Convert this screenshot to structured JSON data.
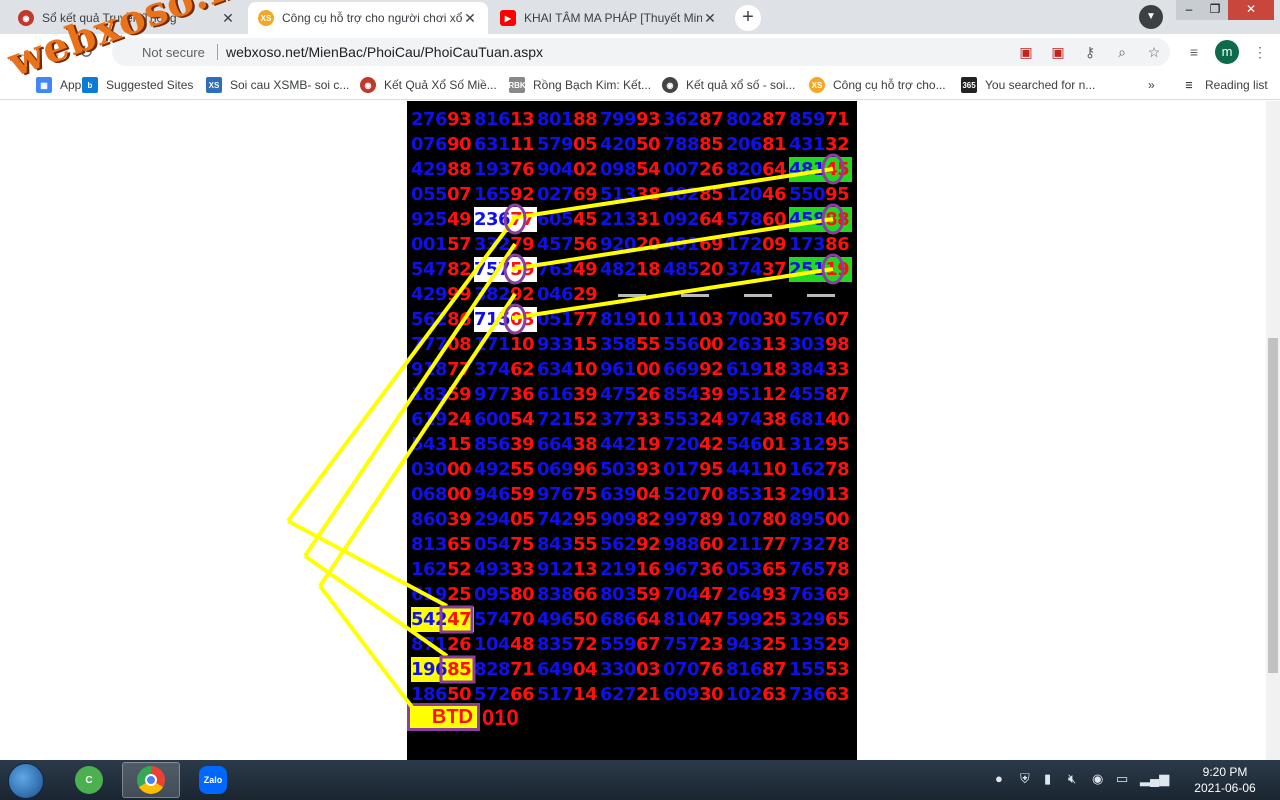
{
  "browser": {
    "tabs": [
      {
        "title": "Sổ kết quả Truyền Thống",
        "icon": "globe-icon",
        "color": "#c0392b",
        "active": false
      },
      {
        "title": "Công cụ hỗ trợ cho người chơi xổ",
        "icon": "xs-icon",
        "color": "#f5a623",
        "active": true
      },
      {
        "title": "KHAI TÂM MA PHÁP [Thuyết Min",
        "icon": "youtube-icon",
        "color": "#ff0000",
        "active": false
      }
    ],
    "security_label": "Not secure",
    "url": "webxoso.net/MienBac/PhoiCau/PhoiCauTuan.aspx",
    "avatar_letter": "m"
  },
  "bookmarks": [
    {
      "label": "Apps",
      "color": "#4285f4"
    },
    {
      "label": "Suggested Sites",
      "color": "#0a7bd6"
    },
    {
      "label": "Soi cau XSMB- soi c...",
      "color": "#2e6fb7"
    },
    {
      "label": "Kết Quả Xổ Số Miề...",
      "color": "#c0392b"
    },
    {
      "label": "Rồng Bạch Kim: Kết...",
      "color": "#888888"
    },
    {
      "label": "Kết quả xổ số - soi...",
      "color": "#444444"
    },
    {
      "label": "Công cụ hỗ trợ cho...",
      "color": "#f5a623"
    },
    {
      "label": "You searched for n...",
      "color": "#222222"
    }
  ],
  "reading_list_label": "Reading list",
  "watermark": "webxoso.net",
  "board": {
    "rows": [
      [
        "27693",
        "81613",
        "80188",
        "79993",
        "36287",
        "80287",
        "85971"
      ],
      [
        "07690",
        "63111",
        "57905",
        "42050",
        "78885",
        "20681",
        "43132"
      ],
      [
        "42988",
        "19376",
        "90402",
        "09854",
        "00726",
        "82064",
        "48145"
      ],
      [
        "05507",
        "16592",
        "02769",
        "51338",
        "40285",
        "12046",
        "55095"
      ],
      [
        "92549",
        "23677",
        "60545",
        "21331",
        "09264",
        "57860",
        "45888"
      ],
      [
        "00157",
        "33279",
        "45756",
        "92020",
        "40169",
        "17209",
        "17386"
      ],
      [
        "54782",
        "75759",
        "76349",
        "48218",
        "48520",
        "37437",
        "25119"
      ],
      [
        "42999",
        "38292",
        "04629",
        "—",
        "—",
        "—",
        "—"
      ],
      [
        "56286",
        "71503",
        "05177",
        "81910",
        "11103",
        "70030",
        "57607"
      ],
      [
        "77708",
        "17110",
        "93315",
        "35855",
        "55600",
        "26313",
        "30398"
      ],
      [
        "91877",
        "37462",
        "63410",
        "96100",
        "66992",
        "61918",
        "38433"
      ],
      [
        "18359",
        "97736",
        "61639",
        "47526",
        "85439",
        "95112",
        "45587"
      ],
      [
        "61924",
        "60054",
        "72152",
        "37733",
        "55324",
        "97438",
        "68140"
      ],
      [
        "54315",
        "85639",
        "66438",
        "44219",
        "72042",
        "54601",
        "31295"
      ],
      [
        "03000",
        "49255",
        "06996",
        "50393",
        "01795",
        "44110",
        "16278"
      ],
      [
        "06800",
        "94659",
        "97675",
        "63904",
        "52070",
        "85313",
        "29013"
      ],
      [
        "86039",
        "29405",
        "74295",
        "90982",
        "99789",
        "10780",
        "89500"
      ],
      [
        "81365",
        "05475",
        "84355",
        "56292",
        "98860",
        "21177",
        "73278"
      ],
      [
        "16252",
        "49333",
        "91213",
        "21916",
        "96736",
        "05365",
        "76578"
      ],
      [
        "61925",
        "09580",
        "83866",
        "80359",
        "70447",
        "26493",
        "76369"
      ],
      [
        "54247",
        "57470",
        "49650",
        "68664",
        "81047",
        "59925",
        "32965"
      ],
      [
        "87126",
        "10448",
        "83572",
        "55967",
        "75723",
        "94325",
        "13529"
      ],
      [
        "19685",
        "82871",
        "64904",
        "33003",
        "07076",
        "81687",
        "15553"
      ],
      [
        "18650",
        "57266",
        "51714",
        "62721",
        "60930",
        "10263",
        "73663"
      ]
    ],
    "btd_label": "BTD",
    "btd_value": "010",
    "colors": {
      "digit_blue": "#1010e8",
      "digit_red": "#ff1010",
      "highlight_green": "#22d822",
      "highlight_yellow": "#ffff00",
      "circle_purple": "#8a3fa0",
      "line_yellow": "#ffff00"
    }
  },
  "taskbar": {
    "apps": [
      "cococ-browser-icon",
      "chrome-icon",
      "zalo-icon"
    ],
    "zalo_label": "Zalo",
    "time": "9:20 PM",
    "date": "2021-06-06"
  }
}
